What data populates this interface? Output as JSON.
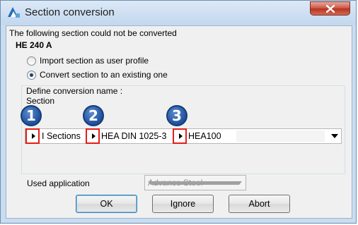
{
  "window": {
    "title": "Section conversion",
    "close_icon": "close-icon"
  },
  "message": "The following section could not be converted",
  "section_name": "HE 240 A",
  "options": [
    {
      "label": "Import section as user profile",
      "checked": false
    },
    {
      "label": "Convert section to an existing one",
      "checked": true
    }
  ],
  "conversion": {
    "group_label": "Define conversion name :",
    "section_label": "Section",
    "segments": [
      "I Sections",
      "HEA DIN 1025-3",
      "HEA100"
    ],
    "markers": [
      "1",
      "2",
      "3"
    ]
  },
  "used_application": {
    "label": "Used application",
    "value": "Advance Steel"
  },
  "buttons": {
    "ok": "OK",
    "ignore": "Ignore",
    "abort": "Abort"
  },
  "colors": {
    "marker_fill": "#1e4f9c",
    "highlight_box": "#e0201b"
  }
}
